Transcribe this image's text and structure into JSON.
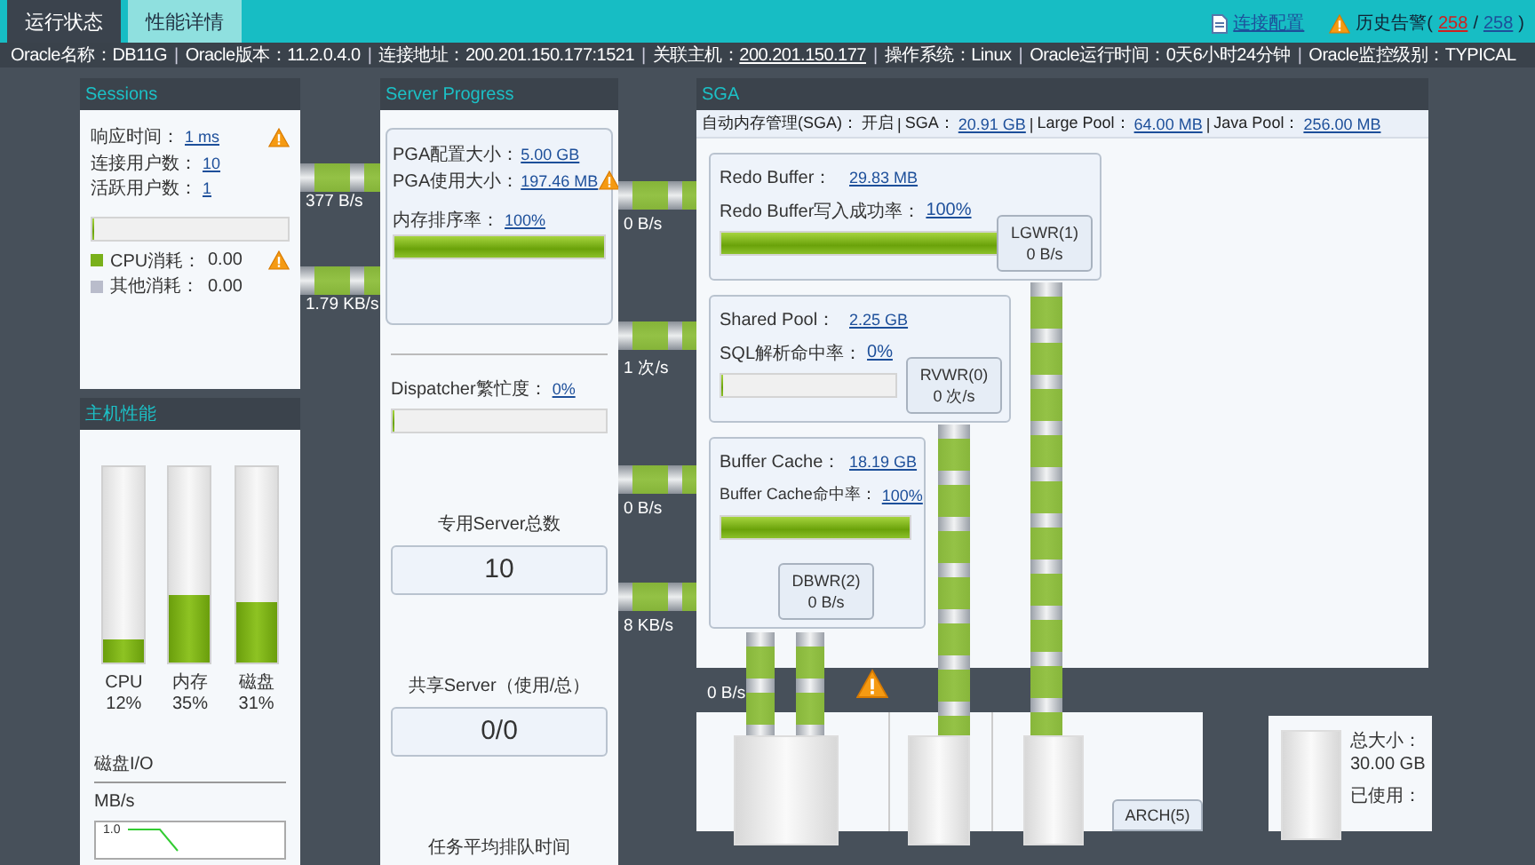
{
  "tabs": [
    {
      "label": "运行状态",
      "selected": true
    },
    {
      "label": "性能详情",
      "selected": false
    }
  ],
  "header_links": {
    "config": "连接配置",
    "alarm_label": "历史告警(",
    "alarm_count": "258",
    "separator": "/",
    "alarm_total": "258",
    "close": ")"
  },
  "info_bar": {
    "separator": "|",
    "items": [
      {
        "label": "Oracle名称：",
        "value": "DB11G",
        "link": false
      },
      {
        "label": "Oracle版本：",
        "value": "11.2.0.4.0",
        "link": false
      },
      {
        "label": "连接地址：",
        "value": "200.201.150.177:1521",
        "link": false
      },
      {
        "label": "关联主机：",
        "value": "200.201.150.177",
        "link": true
      },
      {
        "label": "操作系统：",
        "value": "Linux",
        "link": false
      },
      {
        "label": "Oracle运行时间：",
        "value": "0天6小时24分钟",
        "link": false
      },
      {
        "label": "Oracle监控级别：",
        "value": "TYPICAL",
        "link": false
      }
    ]
  },
  "sessions": {
    "title": "Sessions",
    "metrics": [
      {
        "label": "响应时间：",
        "value": "1 ms",
        "warning": true
      },
      {
        "label": "连接用户数：",
        "value": "10",
        "warning": false
      },
      {
        "label": "活跃用户数：",
        "value": "1",
        "warning": false
      }
    ],
    "level": 0,
    "legend": [
      {
        "label": "CPU消耗：",
        "value": "0.00",
        "color": "#79b01a",
        "warning": true
      },
      {
        "label": "其他消耗：",
        "value": "0.00",
        "color": "#b9bccb",
        "warning": false
      }
    ]
  },
  "host": {
    "title": "主机性能",
    "bars": [
      {
        "name": "CPU",
        "reading": "12%",
        "level": 0.12
      },
      {
        "name": "内存",
        "reading": "35%",
        "level": 0.35
      },
      {
        "name": "磁盘",
        "reading": "31%",
        "level": 0.31
      }
    ],
    "disk_io_title": "磁盘I/O",
    "disk_io_unit": "MB/s",
    "disk_io_tick": "1.0"
  },
  "server_progress": {
    "title": "Server Progress",
    "pga": [
      {
        "label": "PGA配置大小：",
        "value": "5.00 GB",
        "warning": false
      },
      {
        "label": "PGA使用大小：",
        "value": "197.46 MB",
        "warning": true
      }
    ],
    "sort": {
      "label": "内存排序率：",
      "value": "100%",
      "level": 1
    },
    "dispatcher": {
      "label": "Dispatcher繁忙度：",
      "value": "0%",
      "level": 0
    },
    "stats": [
      {
        "label": "专用Server总数",
        "value": "10"
      },
      {
        "label": "共享Server（使用/总）",
        "value": "0/0"
      },
      {
        "label": "任务平均排队时间"
      }
    ]
  },
  "sga": {
    "title": "SGA",
    "separator": "|",
    "summary": [
      {
        "label": "自动内存管理(SGA)：",
        "value": "开启",
        "link": false
      },
      {
        "label": "SGA：",
        "value": "20.91 GB",
        "link": true
      },
      {
        "label": "Large Pool：",
        "value": "64.00 MB",
        "link": true
      },
      {
        "label": "Java Pool：",
        "value": "256.00 MB",
        "link": true
      }
    ],
    "pools": [
      {
        "label": "Redo Buffer：",
        "value": "29.83 MB",
        "rate_label": "Redo Buffer写入成功率：",
        "rate_value": "100%",
        "level": 1,
        "process": "LGWR(1)",
        "process_rate": "0 B/s"
      },
      {
        "label": "Shared Pool：",
        "value": "2.25 GB",
        "rate_label": "SQL解析命中率：",
        "rate_value": "0%",
        "level": 0,
        "process": "RVWR(0)",
        "process_rate": "0 次/s"
      },
      {
        "label": "Buffer Cache：",
        "value": "18.19 GB",
        "rate_label": "Buffer Cache命中率：",
        "rate_value": "100%",
        "level": 1,
        "process": "DBWR(2)",
        "process_rate": "0 B/s"
      }
    ]
  },
  "flows": [
    "377 B/s",
    "1.79 KB/s",
    "0 B/s",
    "1 次/s",
    "0 B/s",
    "8 KB/s",
    "0 B/s"
  ],
  "storage": {
    "warning": true,
    "process": "ARCH(5)",
    "total_label": "总大小：",
    "total": "30.00 GB",
    "used_label": "已使用："
  }
}
